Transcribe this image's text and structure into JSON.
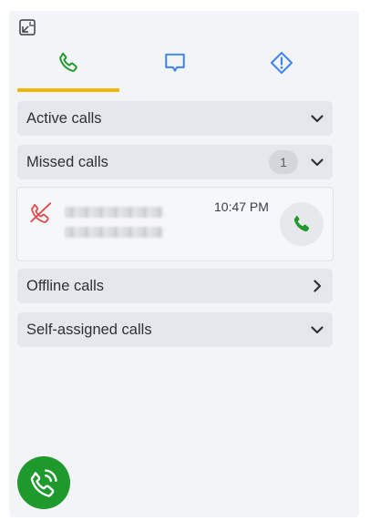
{
  "colors": {
    "accent_underline": "#f5b500",
    "phone_green": "#1e9a2c",
    "chat_blue": "#3b82f6",
    "missed_red": "#e24b4b"
  },
  "header": {
    "collapse_icon": "collapse-window-icon"
  },
  "tabs": [
    {
      "icon": "phone-icon",
      "active": true
    },
    {
      "icon": "chat-bubble-icon",
      "active": false
    },
    {
      "icon": "alert-diamond-icon",
      "active": false
    }
  ],
  "sections": {
    "active": {
      "label": "Active calls",
      "icon": "chevron-down-icon"
    },
    "missed": {
      "label": "Missed calls",
      "count": "1",
      "icon": "chevron-down-icon"
    },
    "offline": {
      "label": "Offline calls",
      "icon": "chevron-right-icon"
    },
    "self_assigned": {
      "label": "Self-assigned calls",
      "icon": "chevron-down-icon"
    }
  },
  "missed_calls": [
    {
      "time": "10:47 PM",
      "status_icon": "missed-call-icon",
      "action_icon": "phone-icon"
    }
  ],
  "fab": {
    "icon": "phone-ringing-icon"
  }
}
